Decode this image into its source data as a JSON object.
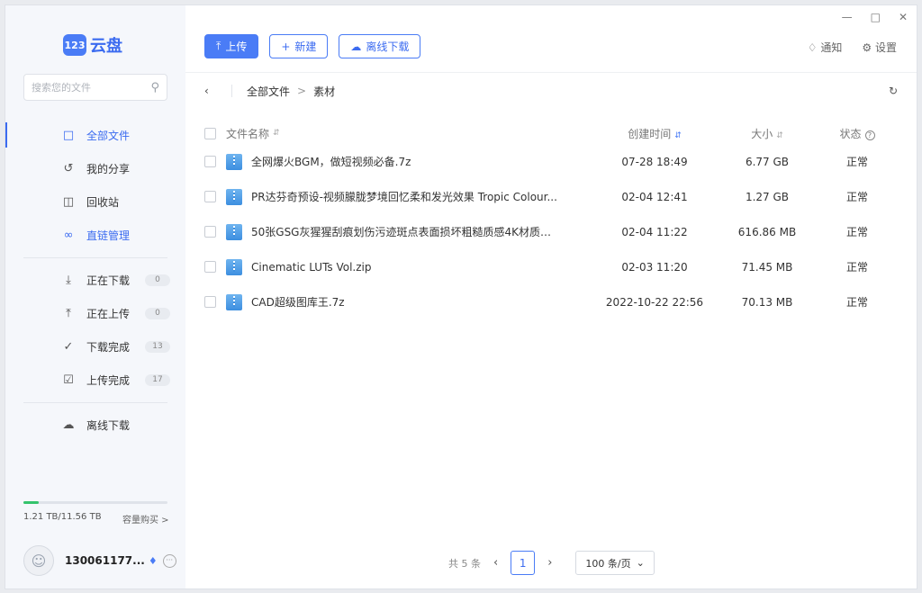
{
  "logo": {
    "mark": "123",
    "text": "云盘"
  },
  "search": {
    "placeholder": "搜索您的文件"
  },
  "sidebar": {
    "items": [
      {
        "label": "全部文件"
      },
      {
        "label": "我的分享"
      },
      {
        "label": "回收站"
      },
      {
        "label": "直链管理"
      }
    ],
    "transfers": [
      {
        "label": "正在下载",
        "count": "0"
      },
      {
        "label": "正在上传",
        "count": "0"
      },
      {
        "label": "下载完成",
        "count": "13"
      },
      {
        "label": "上传完成",
        "count": "17"
      }
    ],
    "offline": {
      "label": "离线下载"
    }
  },
  "storage": {
    "text": "1.21 TB/11.56 TB",
    "buy": "容量购买 >",
    "used_fraction": 0.105
  },
  "user": {
    "name": "130061177..."
  },
  "toolbar": {
    "upload": "上传",
    "new": "新建",
    "offline": "离线下载"
  },
  "topright": {
    "notify": "通知",
    "settings": "设置"
  },
  "breadcrumb": {
    "root": "全部文件",
    "sep": ">",
    "current": "素材"
  },
  "table": {
    "headers": {
      "name": "文件名称",
      "date": "创建时间",
      "size": "大小",
      "status": "状态"
    },
    "rows": [
      {
        "name": "全网爆火BGM，做短视频必备.7z",
        "date": "07-28 18:49",
        "size": "6.77 GB",
        "status": "正常"
      },
      {
        "name": "PR达芬奇预设-视频朦胧梦境回忆柔和发光效果 Tropic Colour...",
        "date": "02-04 12:41",
        "size": "1.27 GB",
        "status": "正常"
      },
      {
        "name": "50张GSG灰猩猩刮痕划伤污迹斑点表面损坏粗糙质感4K材质纹...",
        "date": "02-04 11:22",
        "size": "616.86 MB",
        "status": "正常"
      },
      {
        "name": "Cinematic LUTs Vol.zip",
        "date": "02-03 11:20",
        "size": "71.45 MB",
        "status": "正常"
      },
      {
        "name": "CAD超级图库王.7z",
        "date": "2022-10-22 22:56",
        "size": "70.13 MB",
        "status": "正常"
      }
    ]
  },
  "pager": {
    "total": "共 5 条",
    "page": "1",
    "page_size": "100 条/页"
  },
  "colors": {
    "accent": "#4a7cf6",
    "storage": "#35c36c"
  }
}
